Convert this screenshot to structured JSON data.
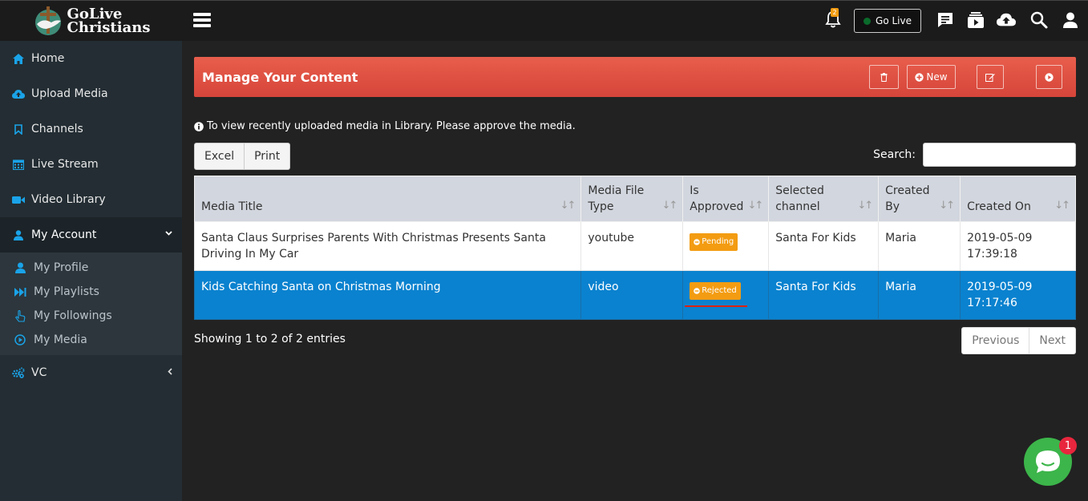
{
  "brand": {
    "logo_text_line1": "GoLive",
    "logo_text_line2": "Christians"
  },
  "colors": {
    "accent": "#1aa3e8",
    "header_red": "#e05142",
    "selected_row": "#0a82cf",
    "badge_orange": "#f39c12",
    "chat_green": "#3cb54a"
  },
  "sidebar": {
    "items": [
      {
        "label": "Home",
        "icon": "home-icon"
      },
      {
        "label": "Upload Media",
        "icon": "cloud-upload-icon"
      },
      {
        "label": "Channels",
        "icon": "bookmark-icon"
      },
      {
        "label": "Live Stream",
        "icon": "calendar-icon"
      },
      {
        "label": "Video Library",
        "icon": "video-camera-icon"
      },
      {
        "label": "My Account",
        "icon": "user-icon"
      },
      {
        "label": "VC",
        "icon": "gears-icon"
      }
    ],
    "submenu": [
      {
        "label": "My Profile",
        "icon": "user-circle-icon"
      },
      {
        "label": "My Playlists",
        "icon": "fast-forward-icon"
      },
      {
        "label": "My Followings",
        "icon": "hand-pointer-icon"
      },
      {
        "label": "My Media",
        "icon": "play-circle-icon"
      }
    ]
  },
  "topbar": {
    "notification_count": "2",
    "golive_label": "Go Live"
  },
  "panel": {
    "title": "Manage Your Content",
    "new_label": "New"
  },
  "info": {
    "text": "To view recently uploaded media in Library. Please approve the media."
  },
  "toolbar": {
    "excel_label": "Excel",
    "print_label": "Print",
    "search_label": "Search:",
    "search_value": ""
  },
  "table": {
    "headers": [
      {
        "line1": "Media Title",
        "line2": ""
      },
      {
        "line1": "Media File",
        "line2": "Type"
      },
      {
        "line1": "Is",
        "line2": "Approved"
      },
      {
        "line1": "Selected",
        "line2": "channel"
      },
      {
        "line1": "Created",
        "line2": "By"
      },
      {
        "line1": "Created On",
        "line2": ""
      }
    ],
    "rows": [
      {
        "title": "Santa Claus Surprises Parents With Christmas Presents Santa Driving In My Car",
        "type": "youtube",
        "approved": "Pending",
        "channel": "Santa For Kids",
        "by": "Maria",
        "date": "2019-05-09",
        "time": "17:39:18"
      },
      {
        "title": "Kids Catching Santa on Christmas Morning",
        "type": "video",
        "approved": "Rejected",
        "channel": "Santa For Kids",
        "by": "Maria",
        "date": "2019-05-09",
        "time": "17:17:46"
      }
    ]
  },
  "footer": {
    "showing": "Showing 1 to 2 of 2 entries",
    "prev_label": "Previous",
    "next_label": "Next"
  },
  "chat": {
    "badge": "1"
  }
}
